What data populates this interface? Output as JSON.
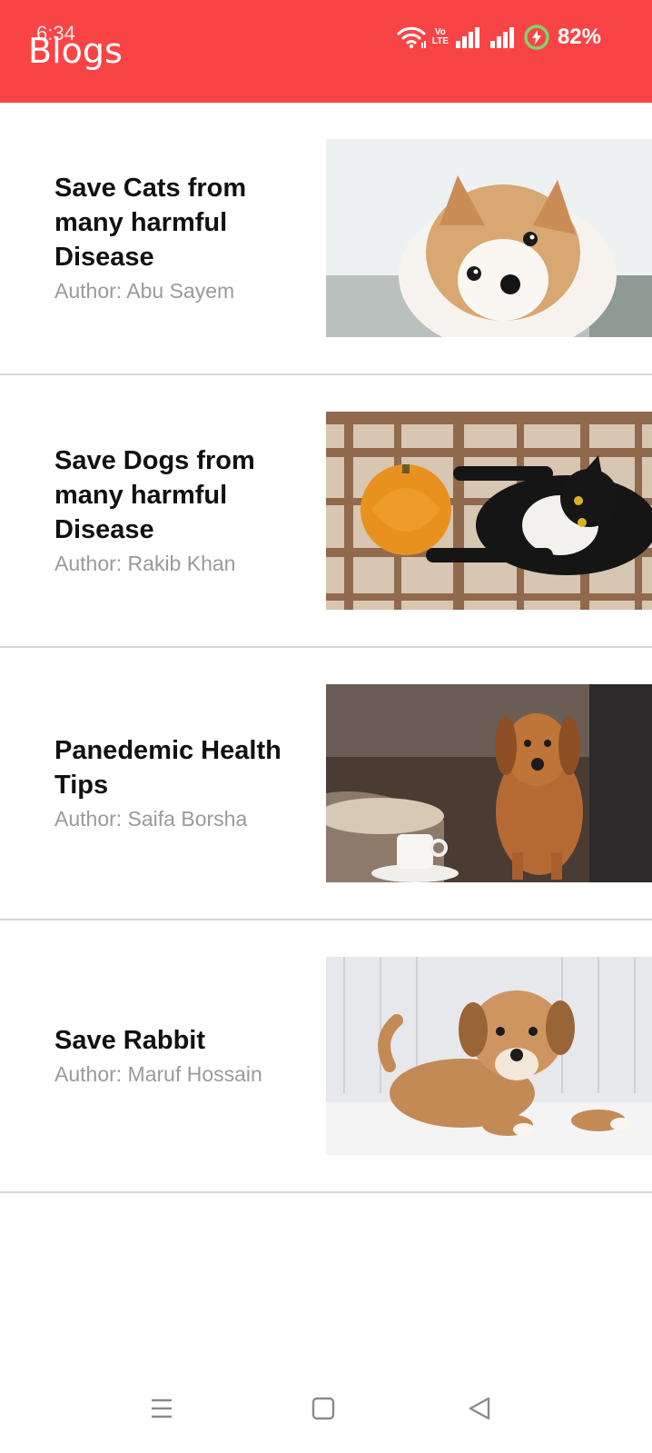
{
  "status_bar": {
    "time": "6:34",
    "volte_top": "Vo",
    "volte_bottom": "LTE",
    "battery_percent": "82%",
    "icons": [
      "wifi-icon",
      "volte-icon",
      "signal-icon",
      "signal-icon",
      "battery-charging-icon"
    ]
  },
  "app_bar": {
    "title": "Blogs",
    "color": "#f94446"
  },
  "blogs": [
    {
      "title": "Save Cats from many harmful Disease",
      "author": "Author: Abu Sayem",
      "image": "pomeranian-dog-photo"
    },
    {
      "title": "Save Dogs from many harmful Disease",
      "author": "Author: Rakib Khan",
      "image": "cat-with-pumpkin-photo"
    },
    {
      "title": "Panedemic Health Tips",
      "author": "Author: Saifa Borsha",
      "image": "dachshund-with-coffee-photo"
    },
    {
      "title": "Save Rabbit",
      "author": "Author: Maruf Hossain",
      "image": "puppy-on-blanket-photo"
    }
  ],
  "nav_bar": {
    "icons": [
      "menu-icon",
      "home-square-icon",
      "back-triangle-icon"
    ]
  }
}
